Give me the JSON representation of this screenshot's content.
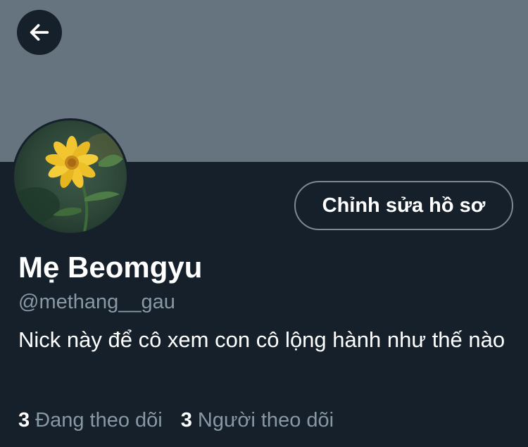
{
  "header": {
    "banner_color": "#66747f",
    "back_icon": "arrow-left-icon"
  },
  "profile": {
    "display_name": "Mẹ Beomgyu",
    "handle": "@methang__gau",
    "bio": "Nick này để cô xem con cô lộng hành như thế nào",
    "edit_button_label": "Chỉnh sửa hồ sơ",
    "avatar_description": "yellow-flower-photo"
  },
  "stats": {
    "following_count": "3",
    "following_label": "Đang theo dõi",
    "followers_count": "3",
    "followers_label": "Người theo dõi"
  },
  "colors": {
    "background": "#15202b",
    "text_primary": "#ffffff",
    "text_secondary": "#8899a6",
    "button_border": "#7b8a97"
  }
}
